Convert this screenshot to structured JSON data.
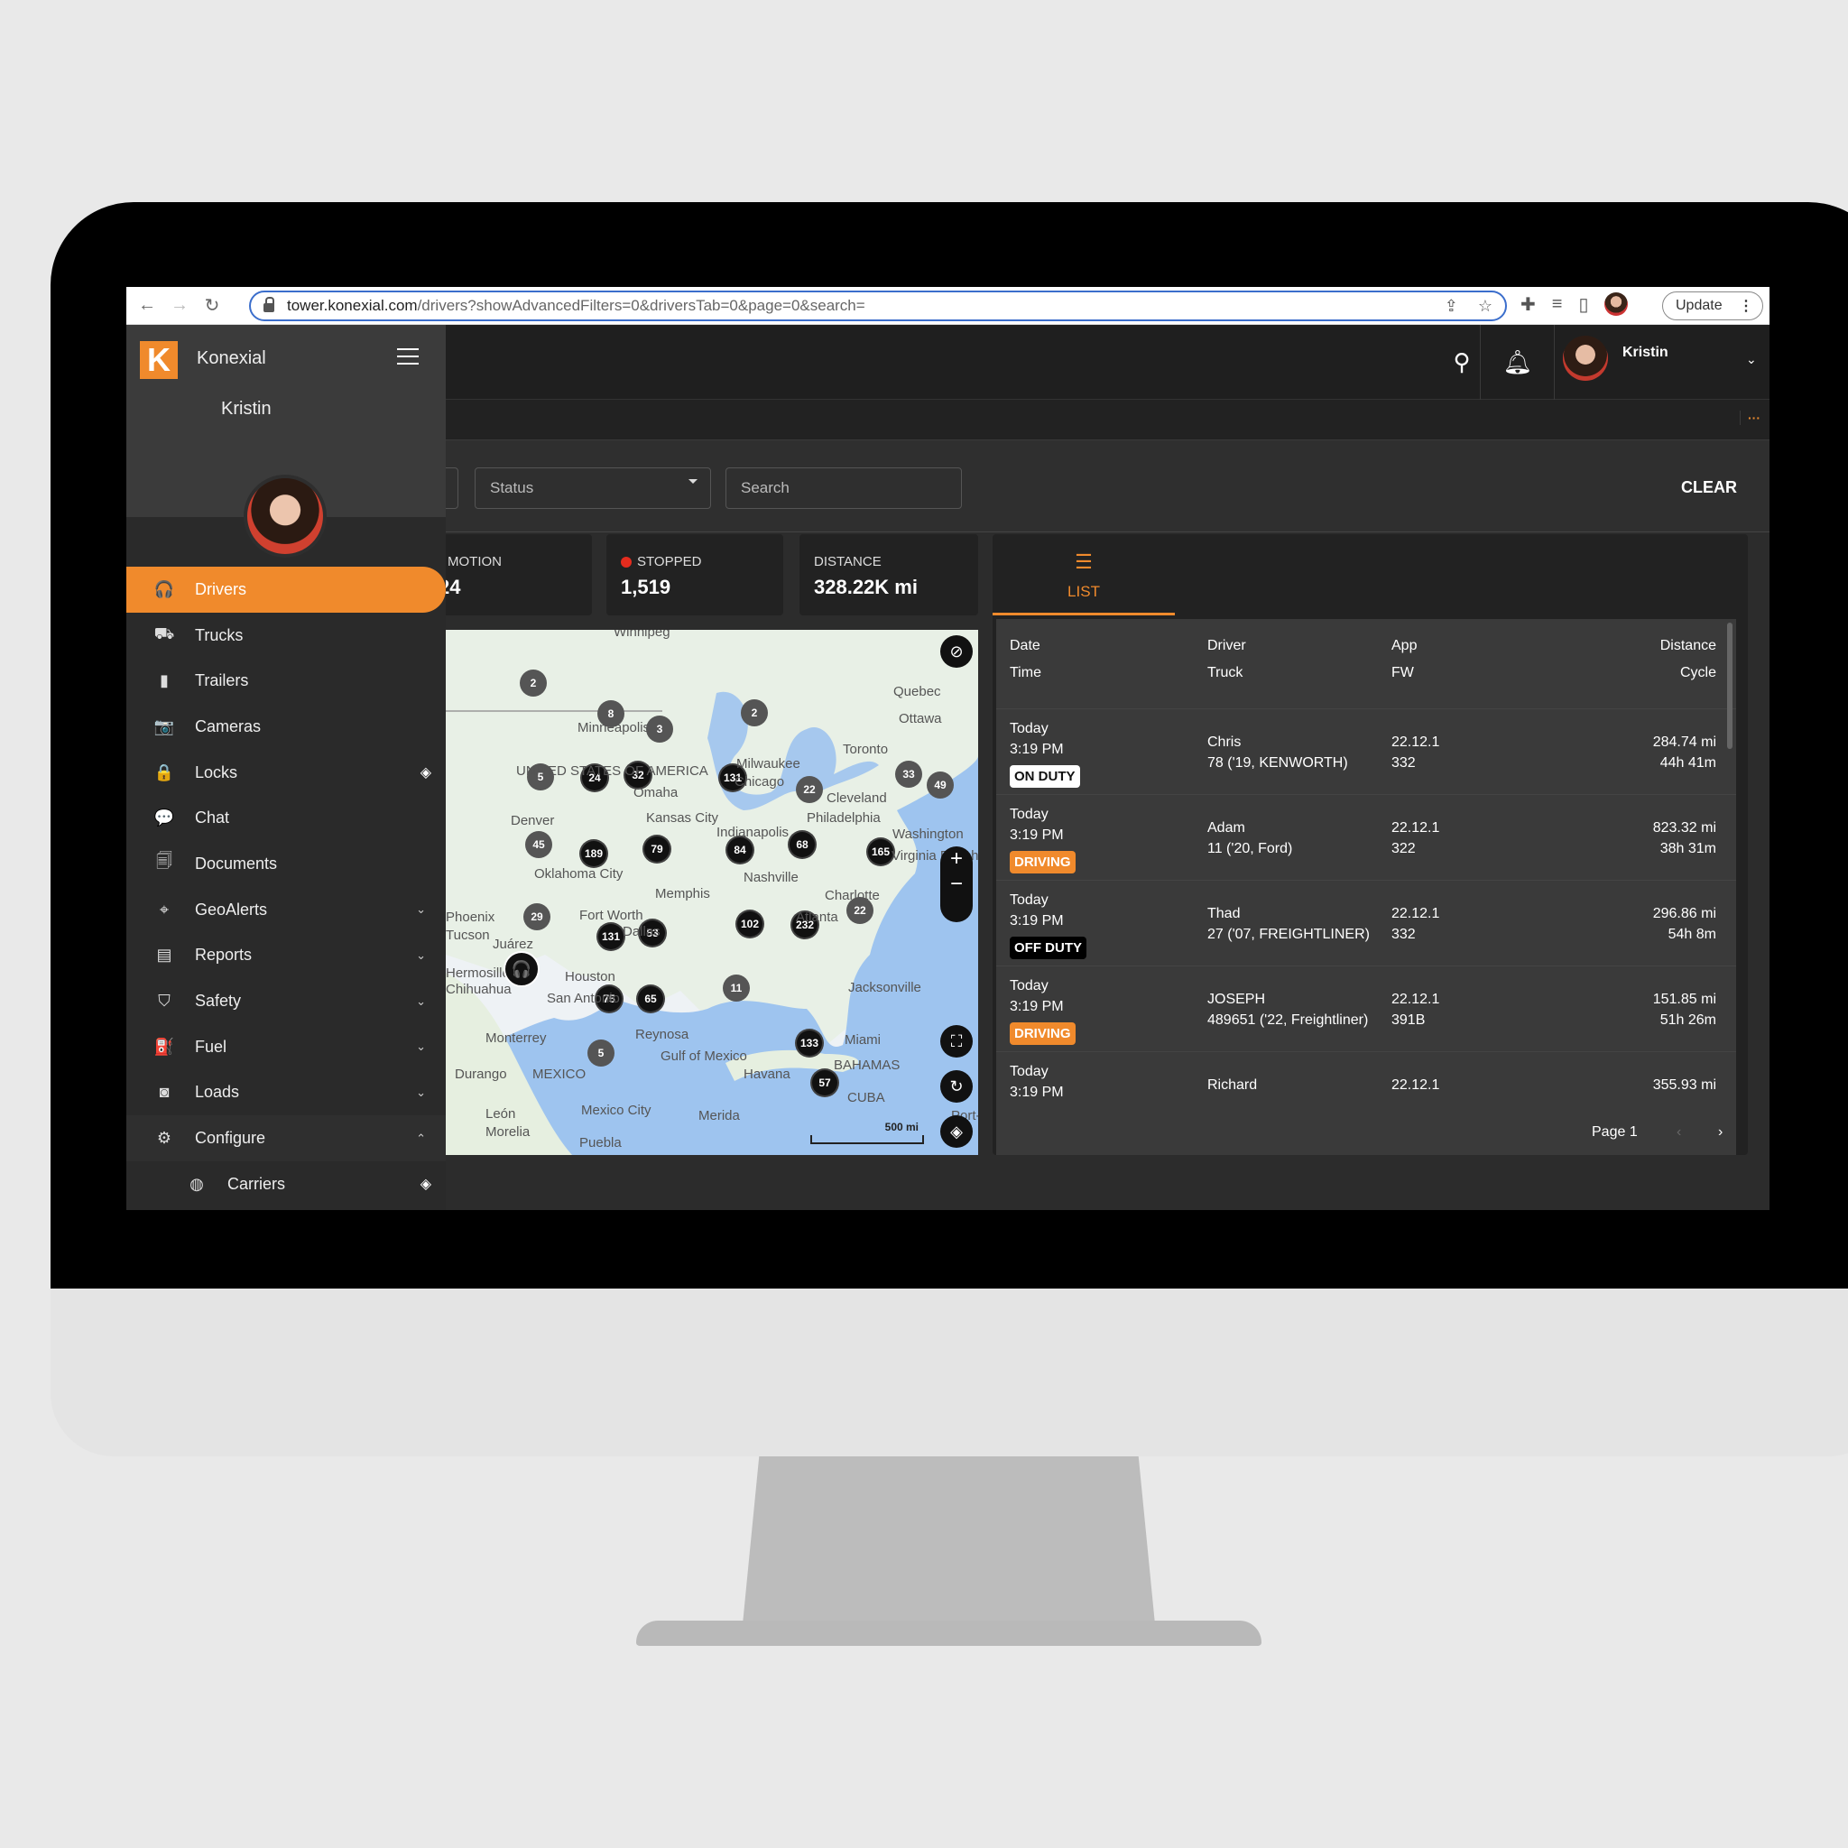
{
  "browser": {
    "url_host": "tower.konexial.com",
    "url_path": "/drivers?showAdvancedFilters=0&driversTab=0&page=0&search=",
    "update_label": "Update"
  },
  "app": {
    "brand": "Konexial",
    "logo_letter": "K",
    "user_name": "Kristin",
    "accent": "#f08a2c"
  },
  "sidebar": {
    "items": [
      {
        "label": "Drivers",
        "icon": "headset-icon",
        "glyph": "🎧",
        "active": true
      },
      {
        "label": "Trucks",
        "icon": "truck-icon",
        "glyph": "⛟"
      },
      {
        "label": "Trailers",
        "icon": "trailer-icon",
        "glyph": "▮"
      },
      {
        "label": "Cameras",
        "icon": "camera-icon",
        "glyph": "📷"
      },
      {
        "label": "Locks",
        "icon": "lock-icon",
        "glyph": "🔒",
        "badge": "◈"
      },
      {
        "label": "Chat",
        "icon": "chat-icon",
        "glyph": "💬"
      },
      {
        "label": "Documents",
        "icon": "document-icon",
        "glyph": "🗐"
      },
      {
        "label": "GeoAlerts",
        "icon": "geoalert-icon",
        "glyph": "⌖",
        "chevron": "⌄"
      },
      {
        "label": "Reports",
        "icon": "report-icon",
        "glyph": "▤",
        "chevron": "⌄"
      },
      {
        "label": "Safety",
        "icon": "shield-icon",
        "glyph": "⛉",
        "chevron": "⌄"
      },
      {
        "label": "Fuel",
        "icon": "fuel-icon",
        "glyph": "⛽",
        "chevron": "⌄"
      },
      {
        "label": "Loads",
        "icon": "loads-icon",
        "glyph": "◙",
        "chevron": "⌄"
      },
      {
        "label": "Configure",
        "icon": "gear-icon",
        "glyph": "⚙",
        "chevron": "⌃"
      },
      {
        "label": "Carriers",
        "icon": "carrier-icon",
        "glyph": "◍",
        "badge": "◈"
      }
    ]
  },
  "filters": {
    "status_placeholder": "Status",
    "search_placeholder": "Search",
    "clear_label": "CLEAR"
  },
  "stats": [
    {
      "label": "MOTION",
      "value": "24"
    },
    {
      "label": "STOPPED",
      "value": "1,519",
      "dot_color": "#e52c1e"
    },
    {
      "label": "DISTANCE",
      "value": "328.22K mi"
    }
  ],
  "map": {
    "scale_label": "500 mi",
    "places": [
      "Winnipeg",
      "Quebec",
      "Ottawa",
      "Toronto",
      "Minneapolis",
      "UNITED STATES OF AMERICA",
      "Omaha",
      "Milwaukee",
      "Chicago",
      "Cleveland",
      "Philadelphia",
      "Washington",
      "Denver",
      "Kansas City",
      "Indianapolis",
      "Virginia Beach",
      "Oklahoma City",
      "Nashville",
      "Memphis",
      "Charlotte",
      "Phoenix",
      "Tucson",
      "Juárez",
      "Fort Worth",
      "Dallas",
      "Atlanta",
      "Hermosillo",
      "Chihuahua",
      "Houston",
      "San Antonio",
      "Jacksonville",
      "Monterrey",
      "Reynosa",
      "Miami",
      "Gulf of Mexico",
      "BAHAMAS",
      "Durango",
      "MEXICO",
      "Havana",
      "CUBA",
      "León",
      "Morelia",
      "Mexico City",
      "Puebla",
      "Merida",
      "Port-au-Prince"
    ],
    "clusters": [
      {
        "count": "2",
        "tone": "gray"
      },
      {
        "count": "8",
        "tone": "gray"
      },
      {
        "count": "3",
        "tone": "gray"
      },
      {
        "count": "2",
        "tone": "gray"
      },
      {
        "count": "5",
        "tone": "gray"
      },
      {
        "count": "24",
        "tone": "dark"
      },
      {
        "count": "32",
        "tone": "dark"
      },
      {
        "count": "131",
        "tone": "dark"
      },
      {
        "count": "22",
        "tone": "gray"
      },
      {
        "count": "33",
        "tone": "gray"
      },
      {
        "count": "49",
        "tone": "gray"
      },
      {
        "count": "45",
        "tone": "gray"
      },
      {
        "count": "189",
        "tone": "dark"
      },
      {
        "count": "79",
        "tone": "dark"
      },
      {
        "count": "84",
        "tone": "dark"
      },
      {
        "count": "68",
        "tone": "dark"
      },
      {
        "count": "165",
        "tone": "dark"
      },
      {
        "count": "22",
        "tone": "gray"
      },
      {
        "count": "29",
        "tone": "gray"
      },
      {
        "count": "131",
        "tone": "dark"
      },
      {
        "count": "53",
        "tone": "dark"
      },
      {
        "count": "102",
        "tone": "dark"
      },
      {
        "count": "232",
        "tone": "dark"
      },
      {
        "count": "11",
        "tone": "gray"
      },
      {
        "count": "75",
        "tone": "dark"
      },
      {
        "count": "65",
        "tone": "dark"
      },
      {
        "count": "133",
        "tone": "dark"
      },
      {
        "count": "5",
        "tone": "gray"
      },
      {
        "count": "57",
        "tone": "dark"
      }
    ]
  },
  "list": {
    "tab_label": "LIST",
    "headers": {
      "date": "Date",
      "time": "Time",
      "driver": "Driver",
      "truck": "Truck",
      "app": "App",
      "fw": "FW",
      "distance": "Distance",
      "cycle": "Cycle"
    },
    "rows": [
      {
        "date": "Today",
        "time": "3:19 PM",
        "status": "ON DUTY",
        "status_kind": "on",
        "driver": "Chris",
        "truck": "78 ('19, KENWORTH)",
        "app": "22.12.1",
        "fw": "332",
        "distance": "284.74 mi",
        "cycle": "44h 41m"
      },
      {
        "date": "Today",
        "time": "3:19 PM",
        "status": "DRIVING",
        "status_kind": "dr",
        "driver": "Adam",
        "truck": "11 ('20, Ford)",
        "app": "22.12.1",
        "fw": "322",
        "distance": "823.32 mi",
        "cycle": "38h 31m"
      },
      {
        "date": "Today",
        "time": "3:19 PM",
        "status": "OFF DUTY",
        "status_kind": "off",
        "driver": "Thad",
        "truck": "27 ('07, FREIGHTLINER)",
        "app": "22.12.1",
        "fw": "332",
        "distance": "296.86 mi",
        "cycle": "54h 8m"
      },
      {
        "date": "Today",
        "time": "3:19 PM",
        "status": "DRIVING",
        "status_kind": "dr",
        "driver": "JOSEPH",
        "truck": "489651 ('22, Freightliner)",
        "app": "22.12.1",
        "fw": "391B",
        "distance": "151.85 mi",
        "cycle": "51h 26m"
      },
      {
        "date": "Today",
        "time": "3:19 PM",
        "status": "",
        "status_kind": "",
        "driver": "Richard",
        "truck": "",
        "app": "22.12.1",
        "fw": "",
        "distance": "355.93 mi",
        "cycle": ""
      }
    ],
    "page_label": "Page 1",
    "prev": "‹",
    "next": "›"
  }
}
